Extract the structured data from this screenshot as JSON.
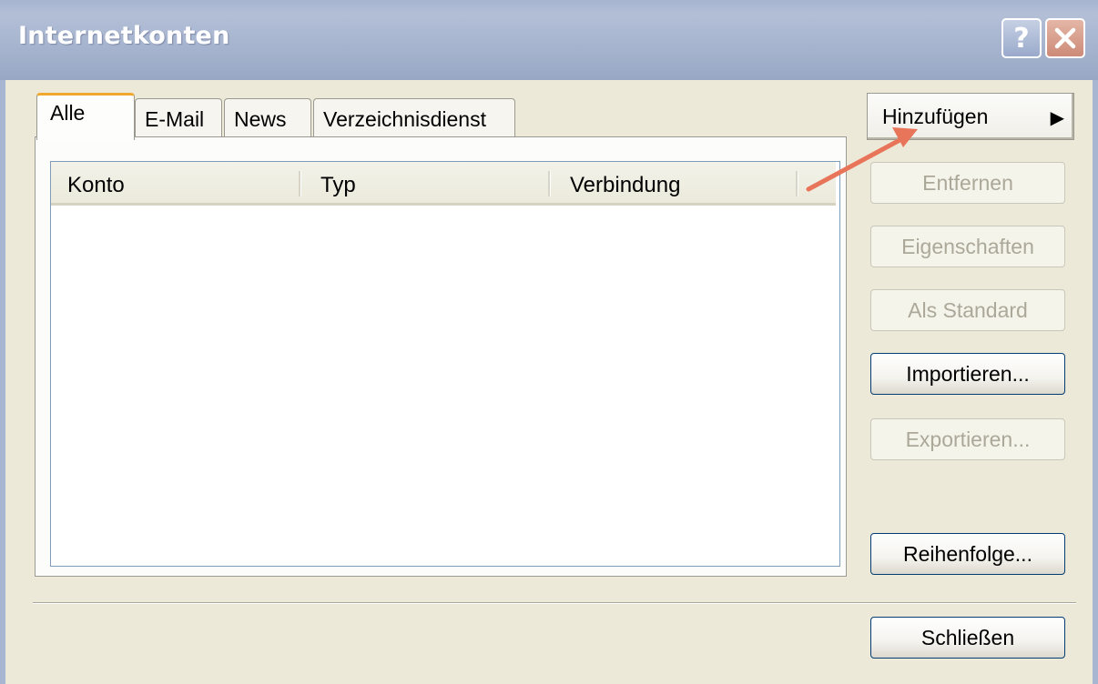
{
  "window": {
    "title": "Internetkonten",
    "help_label": "?",
    "close_label": "×"
  },
  "tabs": [
    {
      "label": "Alle",
      "selected": true
    },
    {
      "label": "E-Mail",
      "selected": false
    },
    {
      "label": "News",
      "selected": false
    },
    {
      "label": "Verzeichnisdienst",
      "selected": false
    }
  ],
  "list": {
    "columns": [
      "Konto",
      "Typ",
      "Verbindung"
    ],
    "rows": []
  },
  "buttons": {
    "add": {
      "label": "Hinzufügen",
      "enabled": true
    },
    "remove": {
      "label": "Entfernen",
      "enabled": false
    },
    "properties": {
      "label": "Eigenschaften",
      "enabled": false
    },
    "set_default": {
      "label": "Als Standard",
      "enabled": false
    },
    "import": {
      "label": "Importieren...",
      "enabled": true
    },
    "export": {
      "label": "Exportieren...",
      "enabled": false
    },
    "order": {
      "label": "Reihenfolge...",
      "enabled": true
    },
    "close": {
      "label": "Schließen",
      "enabled": true
    }
  },
  "colors": {
    "title_bar": "#a9b6d0",
    "face": "#ece9d8",
    "active_tab_accent": "#f0a830",
    "annotation_arrow": "#e8745a",
    "disabled_text": "#aca899"
  }
}
